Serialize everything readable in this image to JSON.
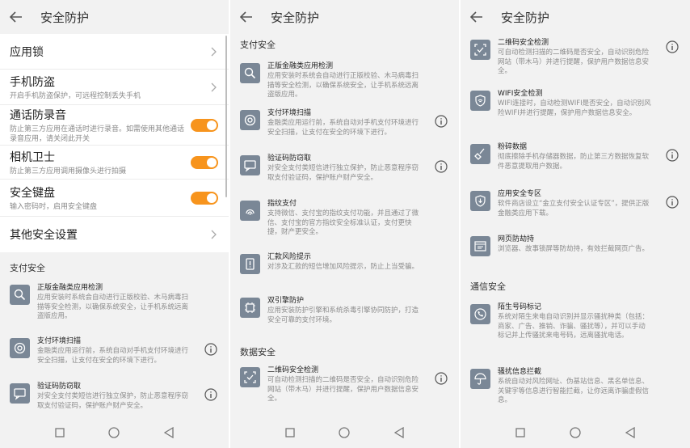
{
  "title": "安全防护",
  "screen1": {
    "settings": [
      {
        "label": "应用锁",
        "sub": "",
        "control": "chevron"
      },
      {
        "label": "手机防盗",
        "sub": "开启手机防盗保护，可远程控制丢失手机",
        "control": "chevron"
      },
      {
        "label": "通话防录音",
        "sub": "防止第三方应用在通话时进行录音。如需使用其他通话录音应用，请关闭此开关",
        "control": "toggle",
        "on": true
      },
      {
        "label": "相机卫士",
        "sub": "防止第三方应用调用摄像头进行拍摄",
        "control": "toggle",
        "on": true
      },
      {
        "label": "安全键盘",
        "sub": "输入密码时，启用安全键盘",
        "control": "toggle",
        "on": true
      },
      {
        "label": "其他安全设置",
        "sub": "",
        "control": "chevron"
      }
    ],
    "section": "支付安全",
    "features": [
      {
        "name": "正版金融类应用检测",
        "desc": "应用安装时系统会自动进行正版校验、木马病毒扫描等安全检测，以确保系统安全，让手机系统远离盗版应用。",
        "info": false
      },
      {
        "name": "支付环境扫描",
        "desc": "金融类应用运行前，系统自动对手机支付环境进行安全扫描，让支付在安全的环境下进行。",
        "info": true
      },
      {
        "name": "验证码防窃取",
        "desc": "对安全支付类短信进行独立保护，防止恶意程序窃取支付验证码，保护账户财产安全。",
        "info": true
      }
    ]
  },
  "screen2": {
    "section_pay": "支付安全",
    "pay_features": [
      {
        "name": "正版金融类应用检测",
        "desc": "应用安装时系统会自动进行正版校验、木马病毒扫描等安全检测，以确保系统安全，让手机系统远离盗版应用。",
        "info": false
      },
      {
        "name": "支付环境扫描",
        "desc": "金融类应用运行前，系统自动对手机支付环境进行安全扫描，让支付在安全的环境下进行。",
        "info": true
      },
      {
        "name": "验证码防窃取",
        "desc": "对安全支付类短信进行独立保护，防止恶意程序窃取支付验证码，保护账户财产安全。",
        "info": true
      },
      {
        "name": "指纹支付",
        "desc": "支持微信、支付宝的指纹支付功能，并且通过了微信、支付宝的官方指纹安全标准认证，支付更快捷，财产更安全。",
        "info": false
      },
      {
        "name": "汇款风险提示",
        "desc": "对涉及汇款的短信增加风险提示，防止上当受骗。",
        "info": false
      },
      {
        "name": "双引擎防护",
        "desc": "应用安装防护引擎和系统杀毒引擎协同防护，打造安全可靠的支付环境。",
        "info": false
      }
    ],
    "section_data": "数据安全",
    "data_features": [
      {
        "name": "二维码安全检测",
        "desc": "可自动检测扫描的二维码是否安全，自动识别危险网站（带木马）并进行提醒，保护用户数据信息安全。",
        "info": true
      }
    ]
  },
  "screen3": {
    "data_features": [
      {
        "name": "二维码安全检测",
        "desc": "可自动检测扫描的二维码是否安全，自动识别危险网站（带木马）并进行提醒，保护用户数据信息安全。",
        "info": true
      },
      {
        "name": "WIFI安全检测",
        "desc": "WIFI连接时，自动检测WIFI是否安全，自动识别风险WIFI并进行提醒，保护用户数据信息安全。",
        "info": false
      },
      {
        "name": "粉碎数据",
        "desc": "彻底擦除手机存储器数据，防止第三方数据恢复软件恶意提取用户数据。",
        "info": true
      },
      {
        "name": "应用安全专区",
        "desc": "软件商店设立“金立支付安全认证专区”，提供正版金融类应用下载。",
        "info": true
      },
      {
        "name": "网页防劫持",
        "desc": "浏览器、故事锁屏等防劫持，有效拦截网页广告。",
        "info": false
      }
    ],
    "section_comm": "通信安全",
    "comm_features": [
      {
        "name": "陌生号码标记",
        "desc": "系统对陌生来电自动识别并显示骚扰种类（包括：商家、广告、推销、诈骗、骚扰等），并可以手动标记并上传骚扰来电号码，远离骚扰电话。",
        "info": false
      },
      {
        "name": "骚扰信息拦截",
        "desc": "系统自动对风险网址、伪基站信息、黑名单信息、关键字等信息进行智能拦截，让你远离诈骗虚假信息。",
        "info": false
      }
    ]
  },
  "colors": {
    "accent": "#f7941d",
    "icon_bg": "#7a8796",
    "bg": "#f2f2f2"
  }
}
